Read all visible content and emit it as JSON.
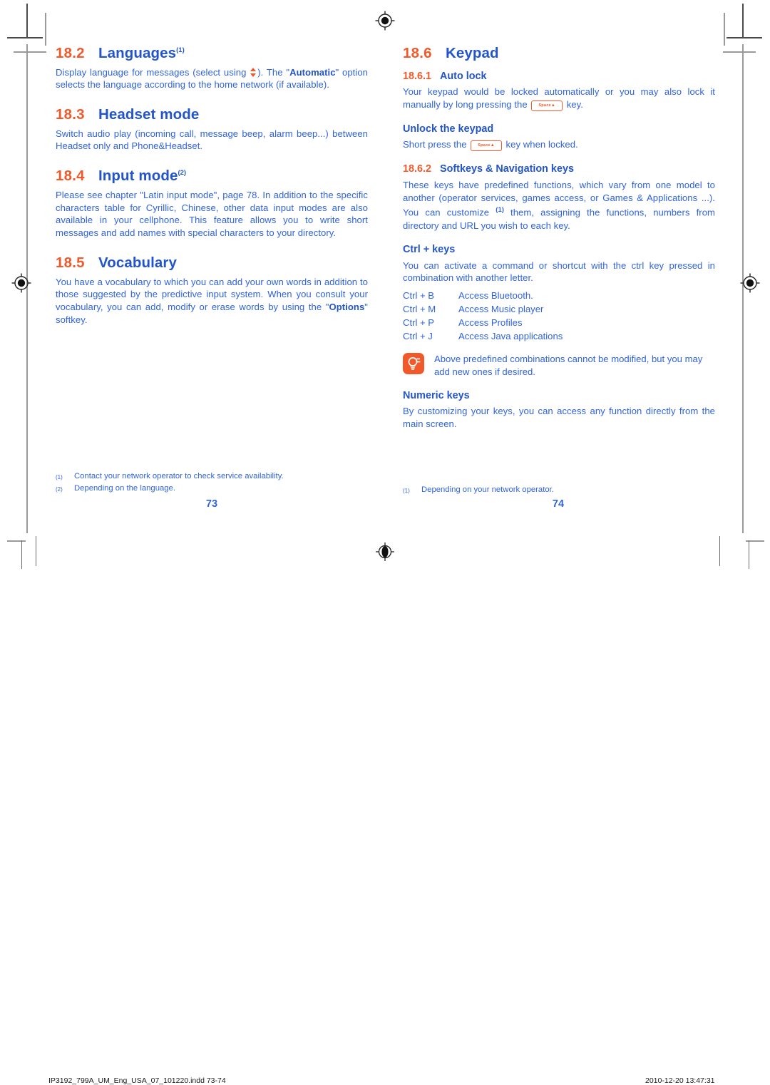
{
  "document": {
    "type": "print-proof-spread",
    "colors": {
      "heading_number": "#F1592A",
      "heading_title": "#2255CC",
      "body_text": "#2F63E0",
      "accent_orange": "#F1592A"
    }
  },
  "left_page": {
    "folio": "73",
    "sections": [
      {
        "number": "18.2",
        "title": "Languages",
        "footnote_marker": "(1)",
        "paragraphs": [
          {
            "before": "Display language for messages (select using ",
            "glyph": "updown-arrow",
            "after_1": "). The \"",
            "bold": "Automatic",
            "after_2": "\" option selects the language according to the home network (if available)."
          }
        ]
      },
      {
        "number": "18.3",
        "title": "Headset mode",
        "footnote_marker": "",
        "text": "Switch audio play (incoming call, message beep, alarm beep...) between Headset only and Phone&Headset."
      },
      {
        "number": "18.4",
        "title": "Input mode",
        "footnote_marker": "(2)",
        "text": "Please see chapter \"Latin input mode\", page 78. In addition to the specific characters table for Cyrillic, Chinese, other data input modes are also available in your cellphone. This feature allows you to write short messages and add names with special characters to your directory."
      },
      {
        "number": "18.5",
        "title": "Vocabulary",
        "footnote_marker": "",
        "paragraph": {
          "before": "You have a vocabulary to which you can add your own words in addition to those suggested by the predictive input system. When you consult your vocabulary, you can add, modify or erase words by using the \"",
          "bold": "Options",
          "after": "\" softkey."
        }
      }
    ],
    "footnotes": [
      {
        "mark": "(1)",
        "text": "Contact your network operator to check service availability."
      },
      {
        "mark": "(2)",
        "text": "Depending on the language."
      }
    ]
  },
  "right_page": {
    "folio": "74",
    "section": {
      "number": "18.6",
      "title": "Keypad"
    },
    "subsections": [
      {
        "number": "18.6.1",
        "title": "Auto lock",
        "paragraph": {
          "before": "Your keypad would be locked automatically or you may also lock it manually by long pressing the ",
          "key": "Space",
          "after": " key."
        },
        "sub_heading": "Unlock the keypad",
        "sub_paragraph": {
          "before": "Short press the ",
          "key": "Space",
          "after": " key when locked."
        }
      },
      {
        "number": "18.6.2",
        "title": "Softkeys & Navigation keys",
        "paragraph": {
          "before": "These keys have predefined functions, which vary from one model to another (operator services, games access, or Games & Applications ...). You can customize ",
          "footnote_marker": "(1)",
          "after": " them, assigning the functions, numbers from directory and URL you wish to each key."
        },
        "ctrl_heading": "Ctrl + keys",
        "ctrl_intro": "You can activate a command or shortcut with the ctrl key pressed in combination with another letter.",
        "shortcuts": [
          {
            "combo": "Ctrl + B",
            "action": "Access Bluetooth."
          },
          {
            "combo": "Ctrl + M",
            "action": "Access Music player"
          },
          {
            "combo": "Ctrl + P",
            "action": "Access Profiles"
          },
          {
            "combo": "Ctrl + J",
            "action": "Access Java applications"
          }
        ],
        "tip": {
          "icon": "lightbulb-icon",
          "text": "Above predefined combinations cannot be modified, but you may add new ones if desired."
        },
        "numeric_heading": "Numeric keys",
        "numeric_text": "By customizing your keys, you can access any function directly from the main screen."
      }
    ],
    "footnotes": [
      {
        "mark": "(1)",
        "text": "Depending on your network operator."
      }
    ]
  },
  "slug": {
    "filename": "IP3192_799A_UM_Eng_USA_07_101220.indd  73-74",
    "timestamp": "2010-12-20  13:47:31"
  }
}
